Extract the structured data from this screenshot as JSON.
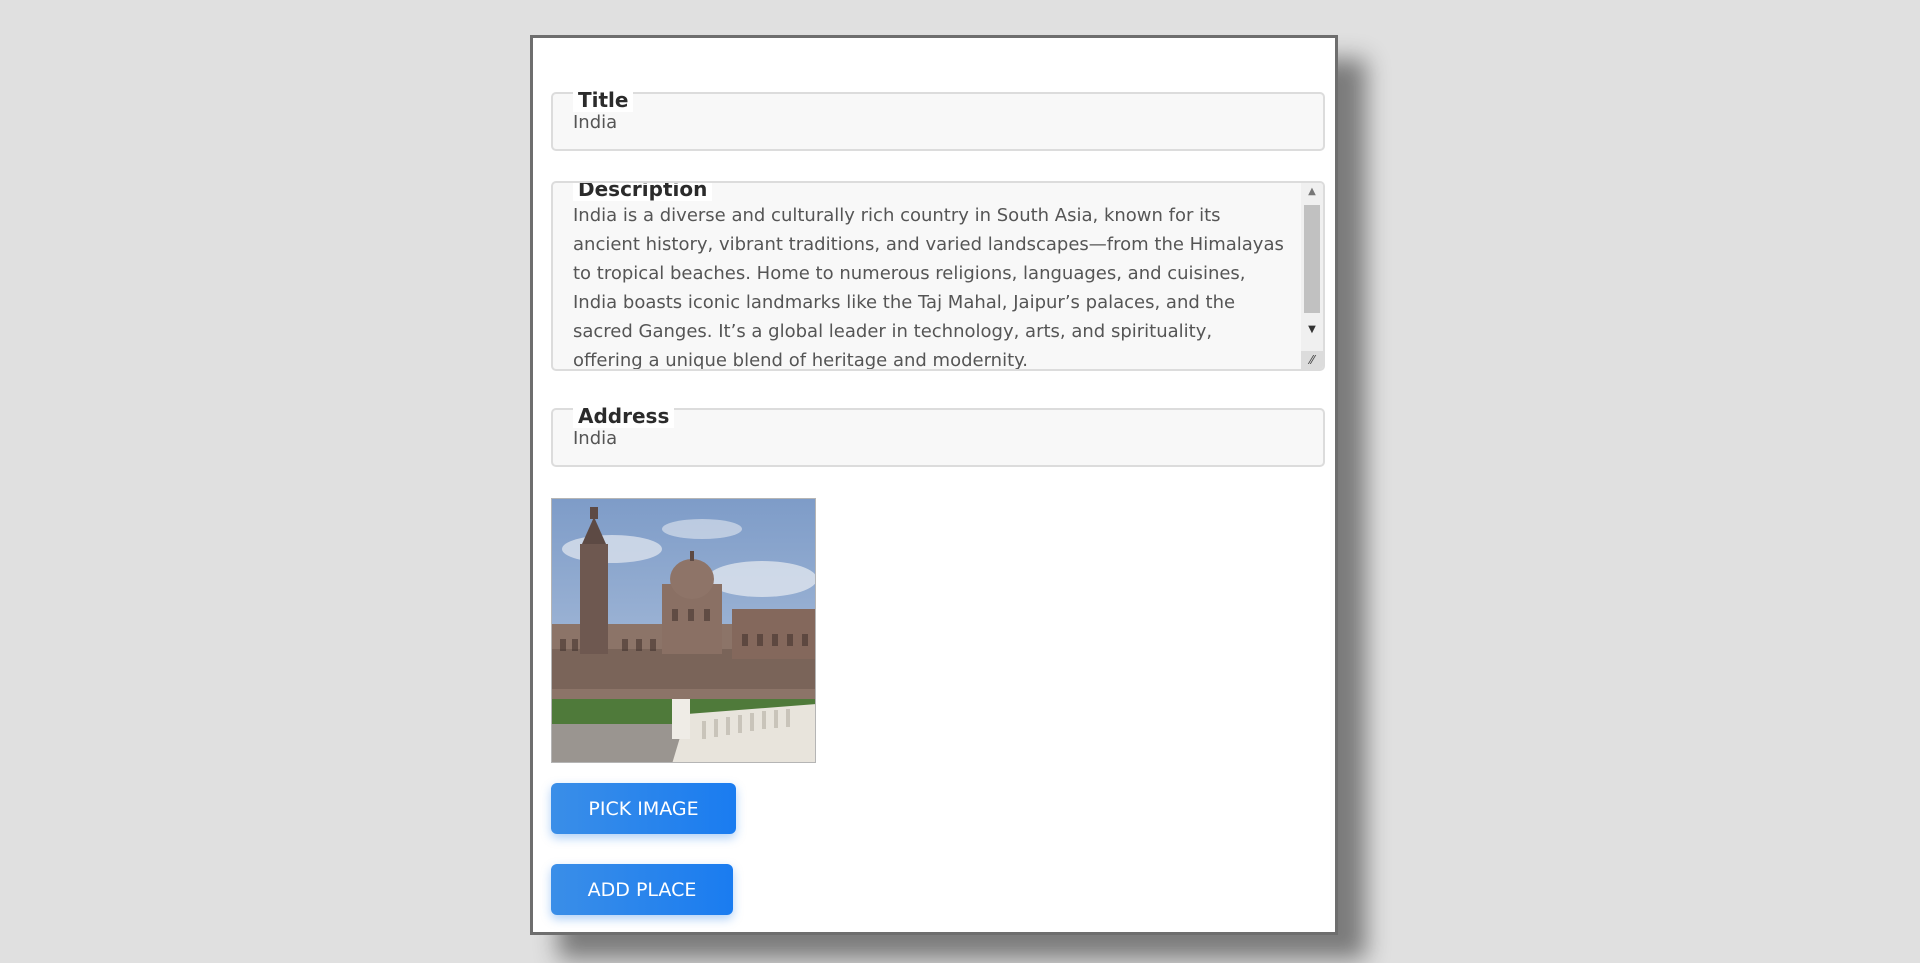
{
  "form": {
    "title_label": "Title",
    "title_value": "India",
    "description_label": "Description",
    "description_value": "India is a diverse and culturally rich country in South Asia, known for its ancient history, vibrant traditions, and varied landscapes—from the Himalayas to tropical beaches. Home to numerous religions, languages, and cuisines, India boasts iconic landmarks like the Taj Mahal, Jaipur’s palaces, and the sacred Ganges. It’s a global leader in technology, arts, and spirituality, offering a unique blend of heritage and modernity.",
    "address_label": "Address",
    "address_value": "India"
  },
  "buttons": {
    "pick_image": "PICK IMAGE",
    "add_place": "ADD PLACE"
  },
  "icons": {
    "scroll_up": "triangle-up-icon",
    "scroll_down": "triangle-down-icon",
    "resize": "resize-grip-icon"
  },
  "colors": {
    "button": "#1a7cf0",
    "background": "#e0e0e0",
    "card": "#ffffff"
  }
}
